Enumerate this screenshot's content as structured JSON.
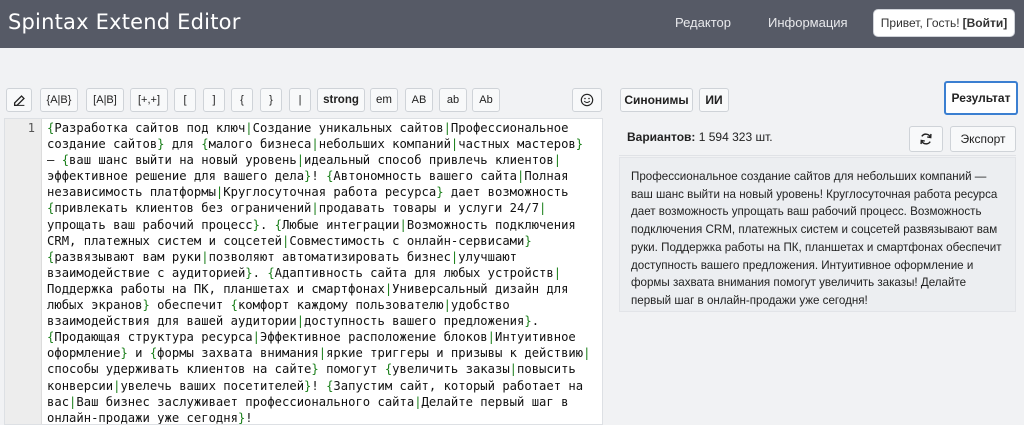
{
  "header": {
    "title": "Spintax Extend Editor",
    "nav": [
      {
        "label": "Редактор"
      },
      {
        "label": "Информация"
      }
    ],
    "greeting": "Привет, Гость!",
    "login": "[Войти]"
  },
  "toolbar": {
    "buttons": [
      {
        "name": "edit-icon",
        "label": ""
      },
      {
        "label": "{A|B}"
      },
      {
        "label": "[A|B]"
      },
      {
        "label": "[+,+]"
      },
      {
        "label": "["
      },
      {
        "label": "]"
      },
      {
        "label": "{"
      },
      {
        "label": "}"
      },
      {
        "label": "|"
      },
      {
        "label": "strong"
      },
      {
        "label": "em"
      },
      {
        "label": "AB"
      },
      {
        "label": "ab"
      },
      {
        "label": "Ab"
      }
    ],
    "emoji_icon": "smile-icon"
  },
  "right_toolbar": {
    "synonyms": "Синонимы",
    "ai": "ИИ",
    "result": "Результат"
  },
  "editor": {
    "line_number": "1",
    "content": "{Разработка сайтов под ключ|Создание уникальных сайтов|Профессиональное создание сайтов} для {малого бизнеса|небольших компаний|частных мастеров} — {ваш шанс выйти на новый уровень|идеальный способ привлечь клиентов|эффективное решение для вашего дела}! {Автономность вашего сайта|Полная независимость платформы|Круглосуточная работа ресурса} дает возможность {привлекать клиентов без ограничений|продавать товары и услуги 24/7|упрощать ваш рабочий процесс}. {Любые интеграции|Возможность подключения CRM, платежных систем и соцсетей|Совместимость с онлайн-сервисами} {развязывают вам руки|позволяют автоматизировать бизнес|улучшают взаимодействие с аудиторией}. {Адаптивность сайта для любых устройств|Поддержка работы на ПК, планшетах и смартфонах|Универсальный дизайн для любых экранов} обеспечит {комфорт каждому пользователю|удобство взаимодействия для вашей аудитории|доступность вашего предложения}. {Продающая структура ресурса|Эффективное расположение блоков|Интуитивное оформление} и {формы захвата внимания|яркие триггеры и призывы к действию|способы удерживать клиентов на сайте} помогут {увеличить заказы|повысить конверсии|увелечь ваших посетителей}! {Запустим сайт, который работает на вас|Ваш бизнес заслуживает профессионального сайта|Делайте первый шаг в онлайн-продажи уже сегодня}!"
  },
  "result": {
    "variants_label": "Вариантов:",
    "variants_value": "1 594 323 шт.",
    "refresh_icon": "refresh-icon",
    "export": "Экспорт",
    "text": "Профессиональное создание сайтов для небольших компаний — ваш шанс выйти на новый уровень! Круглосуточная работа ресурса дает возможность упрощать ваш рабочий процесс. Возможность подключения CRM, платежных систем и соцсетей развязывают вам руки. Поддержка работы на ПК, планшетах и смартфонах обеспечит доступность вашего предложения. Интуитивное оформление и формы захвата внимания помогут увеличить заказы! Делайте первый шаг в онлайн-продажи уже сегодня!"
  },
  "colors": {
    "header_bg": "#565a66",
    "accent_border": "#3b7fd1",
    "brace_color": "#1a7f1a"
  }
}
